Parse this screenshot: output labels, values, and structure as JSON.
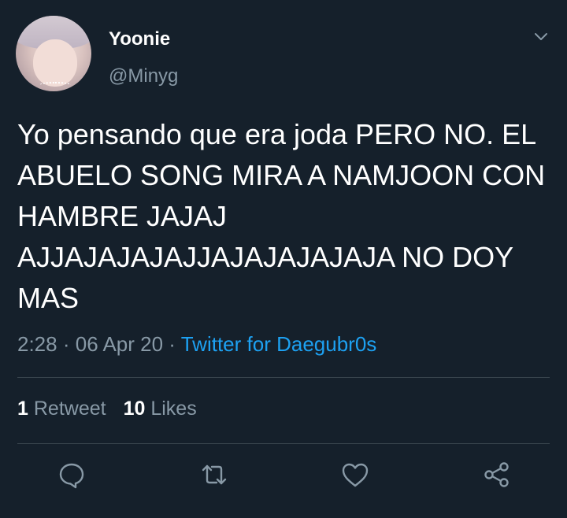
{
  "user": {
    "display_name": "Yoonie",
    "handle": "@Minyg",
    "avatar_icon": "profile-photo"
  },
  "tweet": {
    "text": "Yo pensando que era joda PERO NO. EL ABUELO SONG MIRA A NAMJOON CON HAMBRE JAJAJ AJJAJAJAJAJJAJAJAJAJAJA NO DOY MAS",
    "time": "2:28",
    "separator": "·",
    "date": "06 Apr 20",
    "source": "Twitter for Daegubr0s"
  },
  "stats": {
    "retweets_count": "1",
    "retweets_label": "Retweet",
    "likes_count": "10",
    "likes_label": "Likes"
  },
  "actions": [
    "reply-icon",
    "retweet-icon",
    "like-icon",
    "share-icon"
  ],
  "colors": {
    "background": "#15202b",
    "secondary_text": "#8899a6",
    "link": "#1da1f2",
    "divider": "#38444d"
  }
}
